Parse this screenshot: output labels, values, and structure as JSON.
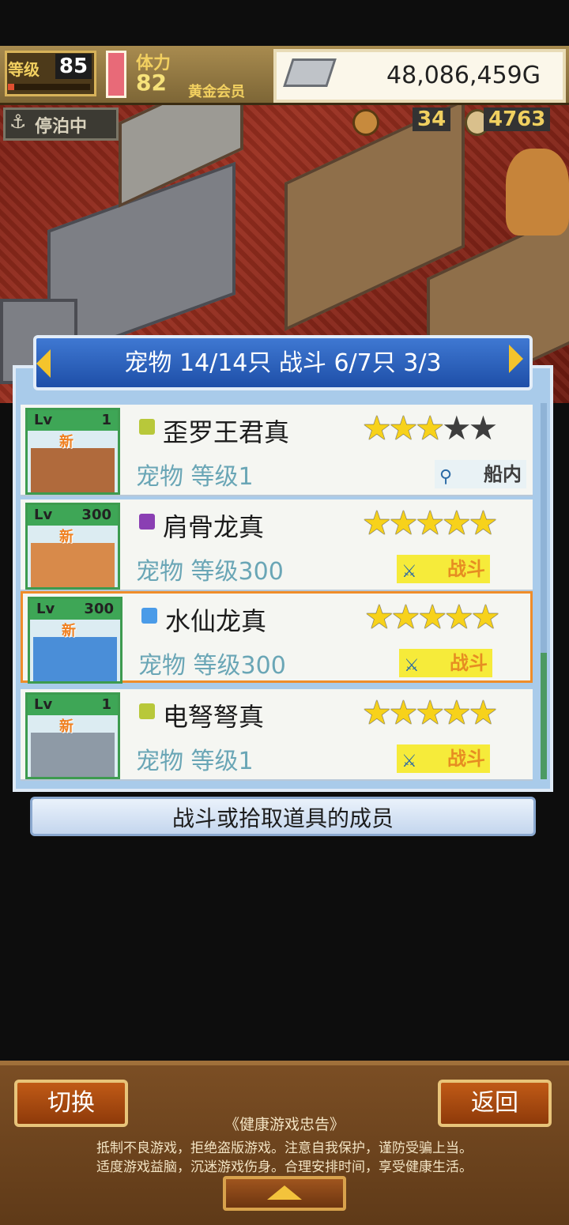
{
  "hud": {
    "level_label": "等级",
    "level_value": "85",
    "level_progress": 0.08,
    "stamina_label": "体力",
    "stamina_value": "82",
    "member_badge": "黄金会员",
    "gold": "48,086,459G",
    "anchor_status": "停泊中",
    "resource_1": "34",
    "resource_2": "4763"
  },
  "list": {
    "header": "宠物 14/14只 战斗 6/7只  3/3",
    "rows": [
      {
        "lv_prefix": "Lv",
        "lv": "1",
        "new": "新",
        "name": "歪罗王君真",
        "sub": "宠物 等级1",
        "stars": 3,
        "status": "船内",
        "status_icon": "magnifier-icon",
        "element_color": "#b8c83a"
      },
      {
        "lv_prefix": "Lv",
        "lv": "300",
        "new": "新",
        "name": "肩骨龙真",
        "sub": "宠物 等级300",
        "stars": 5,
        "status": "战斗",
        "status_icon": "sword-icon",
        "element_color": "#8a3fb3"
      },
      {
        "lv_prefix": "Lv",
        "lv": "300",
        "new": "新",
        "name": "水仙龙真",
        "sub": "宠物 等级300",
        "stars": 5,
        "status": "战斗",
        "status_icon": "sword-icon",
        "element_color": "#4a9be8"
      },
      {
        "lv_prefix": "Lv",
        "lv": "1",
        "new": "新",
        "name": "电弩弩真",
        "sub": "宠物 等级1",
        "stars": 5,
        "status": "战斗",
        "status_icon": "sword-icon",
        "element_color": "#b8c83a"
      }
    ],
    "description": "战斗或拾取道具的成员"
  },
  "footer": {
    "switch_label": "切换",
    "back_label": "返回",
    "notice_title": "《健康游戏忠告》",
    "notice_line1": "抵制不良游戏，拒绝盗版游戏。注意自我保护，谨防受骗上当。",
    "notice_line2": "适度游戏益脑，沉迷游戏伤身。合理安排时间，享受健康生活。"
  }
}
